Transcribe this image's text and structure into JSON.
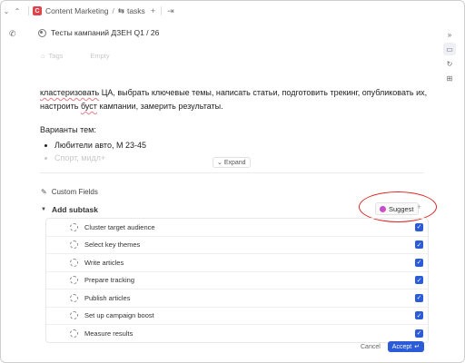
{
  "breadcrumb": {
    "space_badge": "C",
    "space": "Content Marketing",
    "separator": "/",
    "list_icon": "⇆",
    "list": "tasks"
  },
  "task": {
    "title": "Тесты кампаний ДЗЕН Q1 / 26",
    "tags_label": "Tags",
    "tags_value": "Empty"
  },
  "description": {
    "line1_underlined": "кластеризовать",
    "line1_rest": " ЦА, выбрать ключевые темы, написать статьи, подготовить трекинг, опубликовать их,",
    "line2_a": "настроить ",
    "line2_underlined": "буст",
    "line2_b": " кампании, замерить результаты.",
    "variants_label": "Варианты тем:",
    "bullets": [
      "Любители авто, М 23-45",
      "Спорт, мидл+"
    ],
    "expand_label": "Expand"
  },
  "custom_fields_label": "Custom Fields",
  "subtasks": {
    "header": "Add subtask",
    "suggest_label": "Suggest",
    "plus_label": "+",
    "items": [
      {
        "label": "Cluster target audience",
        "checked": true
      },
      {
        "label": "Select key themes",
        "checked": true
      },
      {
        "label": "Write articles",
        "checked": true
      },
      {
        "label": "Prepare tracking",
        "checked": true
      },
      {
        "label": "Publish articles",
        "checked": true
      },
      {
        "label": "Set up campaign boost",
        "checked": true
      },
      {
        "label": "Measure results",
        "checked": true
      }
    ],
    "cancel_label": "Cancel",
    "accept_label": "Accept",
    "accept_icon": "↵"
  },
  "colors": {
    "accent": "#2b5bd7",
    "highlight_ring": "#e02222",
    "space_badge": "#e0434c"
  }
}
